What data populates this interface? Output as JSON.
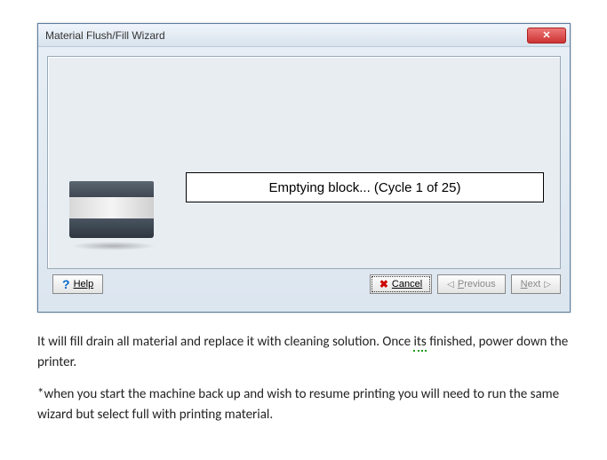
{
  "window": {
    "title": "Material Flush/Fill Wizard",
    "status_message": "Emptying block... (Cycle 1 of 25)",
    "buttons": {
      "help": "Help",
      "cancel": "Cancel",
      "previous": "Previous",
      "next": "Next"
    }
  },
  "instructions": {
    "para1_a": "It will fill drain all material and replace it with cleaning solution.  Once ",
    "para1_its": "its",
    "para1_b": " finished, power down the printer.",
    "para2": "*when you start the machine back up and wish to resume printing you will need to run the same wizard but select full with printing material."
  }
}
